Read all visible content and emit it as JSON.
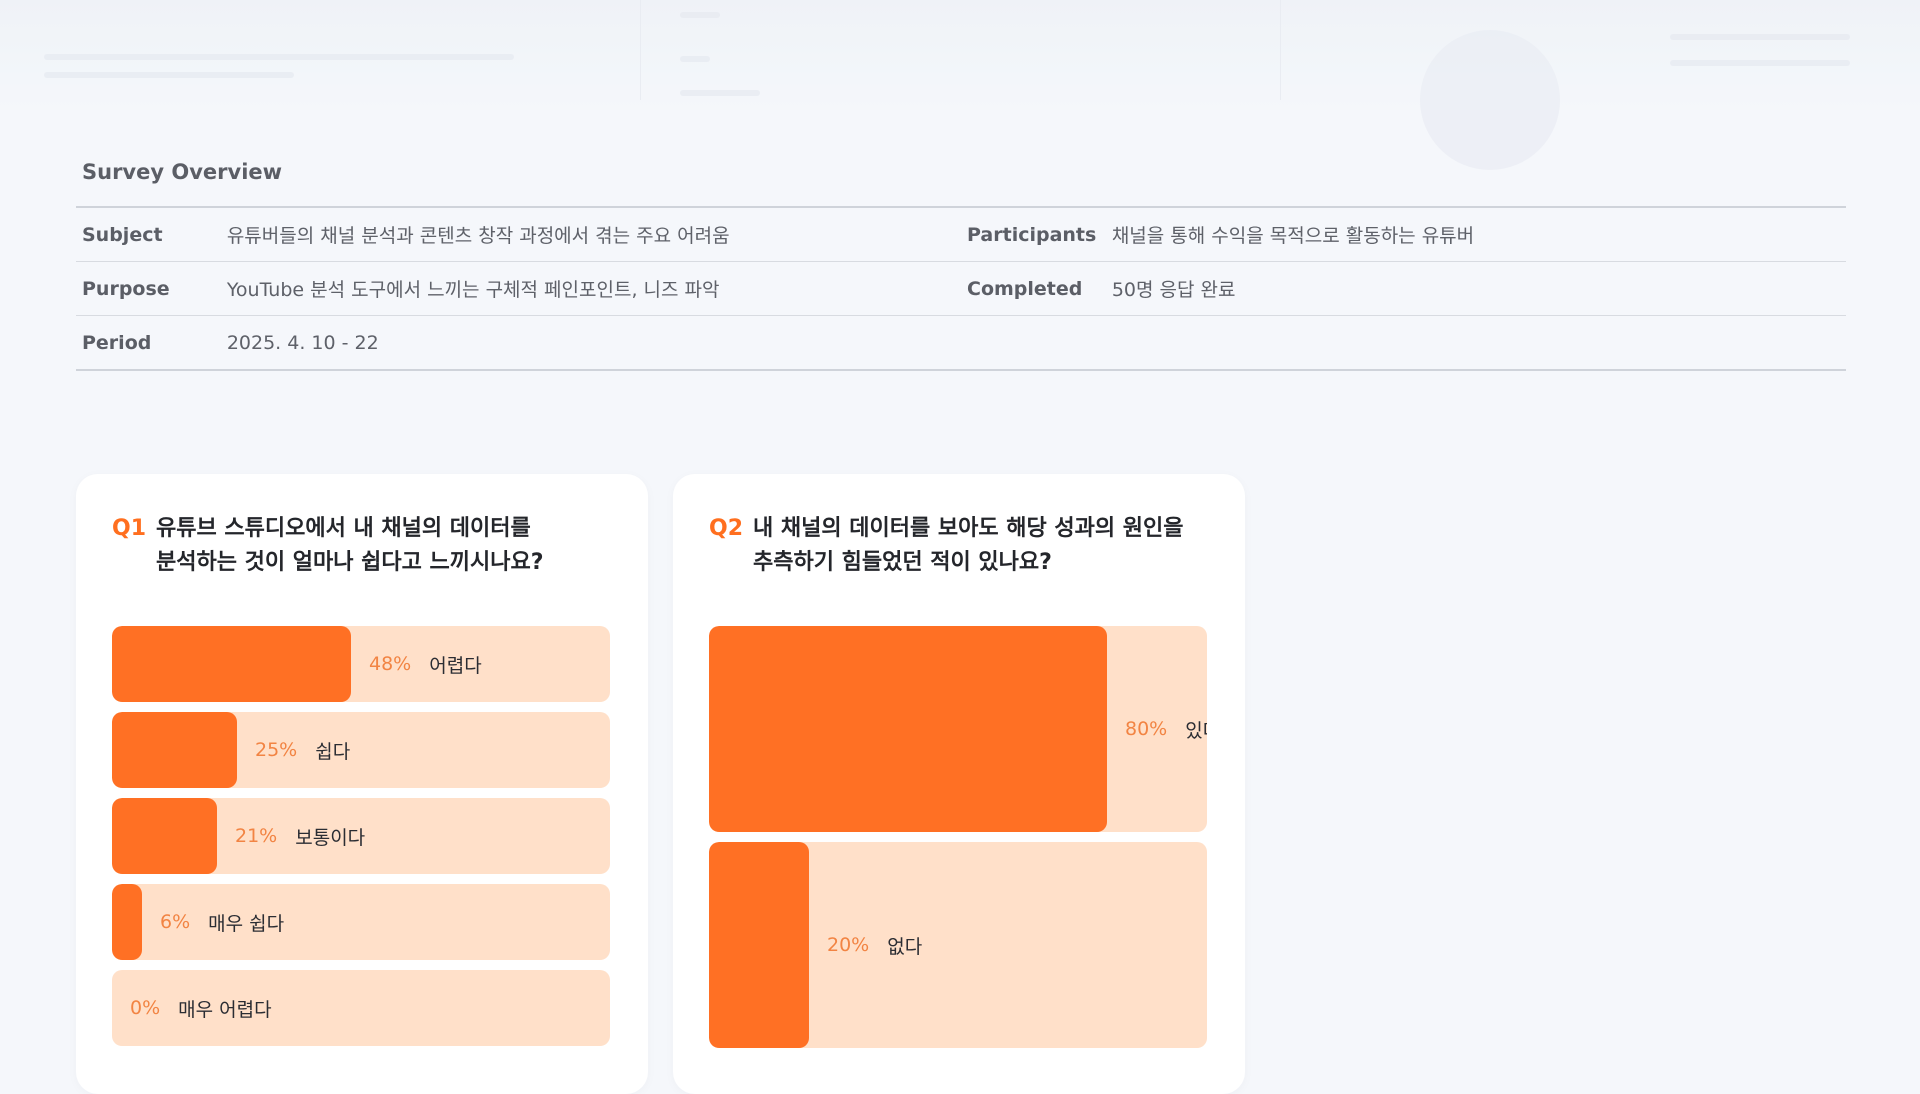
{
  "overview": {
    "title": "Survey Overview",
    "rows": [
      {
        "label1": "Subject",
        "value1": "유튜버들의 채널 분석과 콘텐츠 창작 과정에서 겪는 주요 어려움",
        "label2": "Participants",
        "value2": "채널을 통해 수익을 목적으로 활동하는 유튜버"
      },
      {
        "label1": "Purpose",
        "value1": "YouTube 분석 도구에서 느끼는 구체적 페인포인트, 니즈 파악",
        "label2": "Completed",
        "value2": "50명 응답 완료"
      },
      {
        "label1": "Period",
        "value1": "2025. 4. 10 - 22",
        "label2": "",
        "value2": ""
      }
    ]
  },
  "colors": {
    "accent": "#ff7024",
    "track": "#ffe0c9",
    "percent_text": "#f28443"
  },
  "chart_data": [
    {
      "type": "bar",
      "orientation": "horizontal",
      "number": "Q1",
      "question": "유튜브 스튜디오에서 내 채널의 데이터를 분석하는 것이 얼마나 쉽다고 느끼시나요?",
      "question_line1": "유튜브 스튜디오에서 내 채널의 데이터를",
      "question_line2": "분석하는 것이 얼마나 쉽다고 느끼시나요?",
      "categories": [
        "어렵다",
        "쉽다",
        "보통이다",
        "매우 쉽다",
        "매우 어렵다"
      ],
      "values": [
        48,
        25,
        21,
        6,
        0
      ],
      "value_labels": [
        "48%",
        "25%",
        "21%",
        "6%",
        "0%"
      ],
      "xlim": [
        0,
        100
      ]
    },
    {
      "type": "bar",
      "orientation": "horizontal",
      "number": "Q2",
      "question": "내 채널의 데이터를 보아도 해당 성과의 원인을 추측하기 힘들었던 적이 있나요?",
      "question_line1": "내 채널의 데이터를 보아도 해당 성과의 원인을",
      "question_line2": "추측하기 힘들었던 적이 있나요?",
      "categories": [
        "있다",
        "없다"
      ],
      "values": [
        80,
        20
      ],
      "value_labels": [
        "80%",
        "20%"
      ],
      "xlim": [
        0,
        100
      ]
    }
  ]
}
